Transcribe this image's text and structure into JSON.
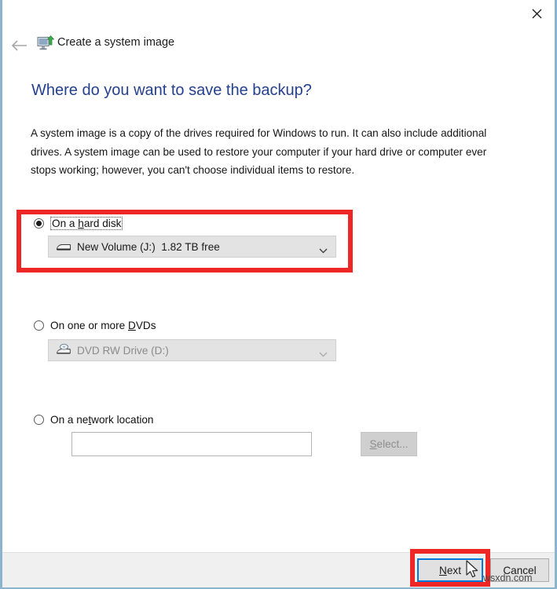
{
  "window": {
    "close_label": "✕",
    "back_label": "←",
    "app_title": "Create a system image",
    "border_color": "#8cb4ce"
  },
  "page": {
    "heading": "Where do you want to save the backup?",
    "heading_color": "#25408f",
    "description": "A system image is a copy of the drives required for Windows to run. It can also include additional drives. A system image can be used to restore your computer if your hard drive or computer ever stops working; however, you can't choose individual items to restore."
  },
  "options": {
    "hard_disk": {
      "label_before": "On a ",
      "label_accel": "h",
      "label_after": "ard disk",
      "selected": true,
      "combo_value": "New Volume (J:)  1.82 TB free",
      "combo_icon": "hard-disk-icon",
      "chevron": "chevron-down-icon",
      "disabled": false
    },
    "dvds": {
      "label_before": "On one or more ",
      "label_accel": "D",
      "label_after": "VDs",
      "selected": false,
      "combo_value": "DVD RW Drive (D:)",
      "combo_icon": "dvd-drive-icon",
      "chevron": "chevron-down-icon",
      "disabled": true
    },
    "network": {
      "label_before": "On a ne",
      "label_accel": "t",
      "label_after": "work location",
      "selected": false,
      "input_value": "",
      "input_placeholder": "",
      "select_button_accel": "S",
      "select_button_after": "elect...",
      "select_disabled": true
    }
  },
  "footer": {
    "next_accel": "N",
    "next_after": "ext",
    "cancel_label": "Cancel"
  },
  "annotations": {
    "color": "#ef2626",
    "hard_disk_box": "highlight-hard-disk-option",
    "next_box": "highlight-next-button"
  },
  "watermark": {
    "text": "wsxdn.com"
  }
}
